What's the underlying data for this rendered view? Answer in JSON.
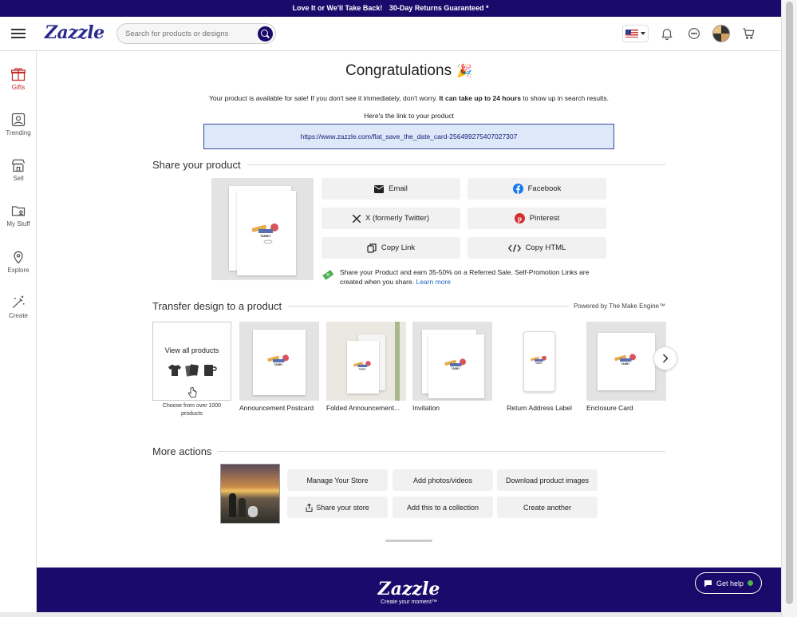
{
  "promo": {
    "left": "Love It or We'll Take Back!",
    "right": "30-Day Returns Guaranteed *"
  },
  "header": {
    "logo": "Zazzle",
    "search_placeholder": "Search for products or designs"
  },
  "sidebar": {
    "items": [
      {
        "label": "Gifts",
        "icon": "gift-icon",
        "active": true
      },
      {
        "label": "Trending",
        "icon": "trending-icon"
      },
      {
        "label": "Sell",
        "icon": "store-icon"
      },
      {
        "label": "My Stuff",
        "icon": "folder-icon"
      },
      {
        "label": "Explore",
        "icon": "location-pin-icon"
      },
      {
        "label": "Create",
        "icon": "magic-wand-icon"
      }
    ]
  },
  "congrats": {
    "title": "Congratulations",
    "emoji": "🎉",
    "available_pre": "Your product is available for sale! If you don't see it immediately, don't worry.",
    "available_bold": "It can take up to 24 hours",
    "available_post": "to show up in search results.",
    "link_label": "Here's the link to your product",
    "url": "https://www.zazzle.com/flat_save_the_date_card-256499275407027307"
  },
  "share": {
    "heading": "Share your product",
    "buttons": {
      "email": "Email",
      "facebook": "Facebook",
      "twitter": "X (formerly Twitter)",
      "pinterest": "Pinterest",
      "copy_link": "Copy Link",
      "copy_html": "Copy HTML"
    },
    "earn_text": "Share your Product and earn 35-50% on a Referred Sale. Self-Promotion Links are created when you share.",
    "learn_more": "Learn more"
  },
  "transfer": {
    "heading": "Transfer design to a product",
    "powered": "Powered by The Make Engine™",
    "view_all": "View all products",
    "view_all_sub": "Choose from over 1000 products",
    "products": [
      "Announcement Postcard",
      "Folded Announcement...",
      "Invitation",
      "Return Address Label",
      "Enclosure Card"
    ]
  },
  "more_actions": {
    "heading": "More actions",
    "buttons": {
      "manage_store": "Manage Your Store",
      "add_media": "Add photos/videos",
      "download_images": "Download product images",
      "share_store": "Share your store",
      "add_collection": "Add this to a collection",
      "create_another": "Create another"
    }
  },
  "footer": {
    "logo": "Zazzle",
    "tagline": "Create your moment™",
    "get_help": "Get help"
  },
  "colors": {
    "brand_navy": "#1a0a6b",
    "active_red": "#c62828",
    "link_blue": "#2563c4",
    "url_box_bg": "#dde8f8"
  }
}
